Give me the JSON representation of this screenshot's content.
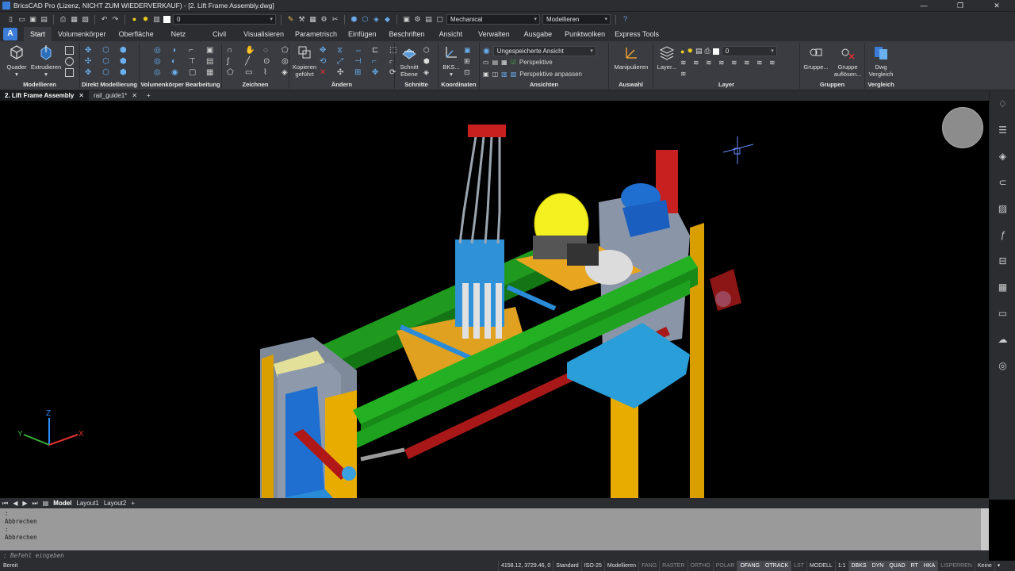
{
  "window": {
    "title": "BricsCAD Pro (Lizenz, NICHT ZUM WIEDERVERKAUF) - [2. Lift Frame Assembly.dwg]",
    "controls": [
      "—",
      "❐",
      "✕"
    ]
  },
  "quick_access": {
    "layer_value": "0",
    "workspace": "Mechanical",
    "mode": "Modellieren"
  },
  "ribbon_tabs": [
    "Start",
    "Volumenkörper",
    "Oberfläche",
    "Netz",
    "Civil",
    "Visualisieren",
    "Parametrisch",
    "Einfügen",
    "Beschriften",
    "Ansicht",
    "Verwalten",
    "Ausgabe",
    "Punktwolken",
    "Express Tools"
  ],
  "ribbon": {
    "groups": {
      "modellieren": "Modellieren",
      "direkt": "Direkt Modellierung",
      "bearbeitung": "Volumenkörper Bearbeitung",
      "zeichnen": "Zeichnen",
      "aendern": "Ändern",
      "schnitte": "Schnitte",
      "koordinaten": "Koordinaten",
      "ansichten": "Ansichten",
      "auswahl": "Auswahl",
      "layer": "Layer",
      "gruppen": "Gruppen",
      "vergleich": "Vergleich"
    },
    "buttons": {
      "quader": "Quader",
      "extrudieren": "Extrudieren",
      "kopieren": "Kopieren",
      "gefuehrt": "geführt",
      "schnitt": "Schnitt",
      "ebene": "Ebene",
      "bks": "BKS...",
      "manipulieren": "Manipulieren",
      "layer_btn": "Layer...",
      "gruppe": "Gruppe...",
      "gruppe_aufloesen_1": "Gruppe",
      "gruppe_aufloesen_2": "auflösen...",
      "dwg": "Dwg",
      "vergleich": "Vergleich"
    },
    "views": {
      "current_view": "Ungespeicherte Ansicht",
      "perspektive": "Perspektive",
      "perspektive_anpassen": "Perspektive anpassen"
    },
    "layer_current": "0"
  },
  "doc_tabs": [
    {
      "label": "2. Lift Frame Assembly",
      "active": true
    },
    {
      "label": "rail_guide1*",
      "active": false
    }
  ],
  "layout_tabs": [
    "Model",
    "Layout1",
    "Layout2",
    "+"
  ],
  "command_history": [
    ":",
    "Abbrechen",
    ":",
    "Abbrechen"
  ],
  "command_prompt": ": Befehl eingeben",
  "status": {
    "ready": "Bereit",
    "coords": "4158.12, 3729.46, 0",
    "items": [
      {
        "label": "Standard",
        "state": "normal"
      },
      {
        "label": "ISO-25",
        "state": "normal"
      },
      {
        "label": "Modellieren",
        "state": "normal"
      },
      {
        "label": "FANG",
        "state": "off"
      },
      {
        "label": "RASTER",
        "state": "off"
      },
      {
        "label": "ORTHO",
        "state": "off"
      },
      {
        "label": "POLAR",
        "state": "off"
      },
      {
        "label": "OFANG",
        "state": "on"
      },
      {
        "label": "OTRACK",
        "state": "on"
      },
      {
        "label": "LST",
        "state": "off"
      },
      {
        "label": "MODELL",
        "state": "normal"
      },
      {
        "label": "1:1",
        "state": "normal"
      },
      {
        "label": "DBKS",
        "state": "on"
      },
      {
        "label": "DYN",
        "state": "on"
      },
      {
        "label": "QUAD",
        "state": "on"
      },
      {
        "label": "RT",
        "state": "on"
      },
      {
        "label": "HKA",
        "state": "on"
      },
      {
        "label": "LISPERREN",
        "state": "off"
      },
      {
        "label": "Keine",
        "state": "normal"
      }
    ]
  },
  "axes": {
    "x": "X",
    "y": "Y",
    "z": "Z"
  },
  "colors": {
    "accent": "#3b7dd8",
    "green_beam": "#1fa31f",
    "yellow_frame": "#e0a800",
    "blue_part": "#29a3e0",
    "red_part": "#b01818"
  }
}
